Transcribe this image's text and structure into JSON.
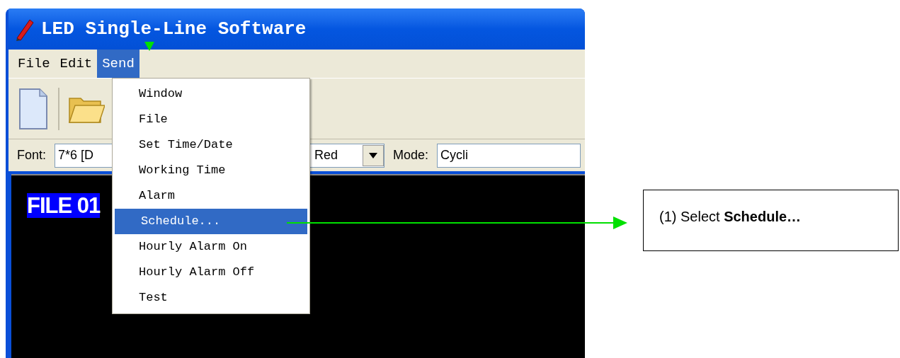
{
  "window": {
    "title": "LED Single-Line Software"
  },
  "menu_bar": [
    {
      "label": "File",
      "selected": false
    },
    {
      "label": "Edit",
      "selected": false
    },
    {
      "label": "Send",
      "selected": true
    }
  ],
  "send_menu": [
    {
      "label": "Window",
      "selected": false
    },
    {
      "label": "File",
      "selected": false
    },
    {
      "label": "Set Time/Date",
      "selected": false
    },
    {
      "label": "Working Time",
      "selected": false
    },
    {
      "label": "Alarm",
      "selected": false
    },
    {
      "label": "Schedule...",
      "selected": true
    },
    {
      "label": "Hourly Alarm On",
      "selected": false
    },
    {
      "label": "Hourly Alarm Off",
      "selected": false
    },
    {
      "label": "Test",
      "selected": false
    }
  ],
  "format_bar": {
    "font_label": "Font:",
    "font_value": "7*6 [D",
    "color_value": "Red",
    "mode_label": "Mode:",
    "mode_value": "Cycli"
  },
  "display": {
    "text": "FILE 01"
  },
  "callout": {
    "text": "(1) Select **Schedule…**"
  }
}
